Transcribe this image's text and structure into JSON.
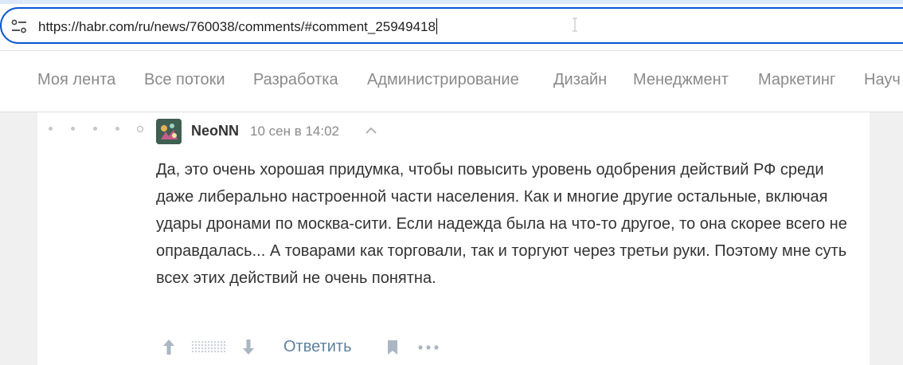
{
  "browser": {
    "url": "https://habr.com/ru/news/760038/comments/#comment_25949418",
    "site_info_icon": "tune-icon"
  },
  "nav": {
    "items": [
      {
        "label": "Моя лента"
      },
      {
        "label": "Все потоки"
      },
      {
        "label": "Разработка"
      },
      {
        "label": "Администрирование"
      },
      {
        "label": "Дизайн"
      },
      {
        "label": "Менеджмент"
      },
      {
        "label": "Маркетинг"
      },
      {
        "label": "Науч"
      }
    ]
  },
  "comment": {
    "author": "NeoNN",
    "timestamp": "10 сен в 14:02",
    "text": "Да, это очень хорошая придумка, чтобы повысить уровень одобрения действий РФ среди даже либерально настроенной части населения. Как и многие другие остальные, включая удары дронами по москва-сити. Если надежда была на что-то другое, то она скорее всего не оправдалась... А товарами как торговали, так и торгуют через третьи руки. Поэтому мне суть всех этих действий не очень понятна.",
    "actions": {
      "reply_label": "Ответить",
      "icons": [
        "arrow-up-icon",
        "arrow-down-icon",
        "bookmark-icon",
        "more-icon"
      ]
    }
  },
  "colors": {
    "url_border": "#0b57d0",
    "link": "#5e7fa0",
    "nav_text": "#8a8a8a",
    "body_text": "#333333"
  }
}
